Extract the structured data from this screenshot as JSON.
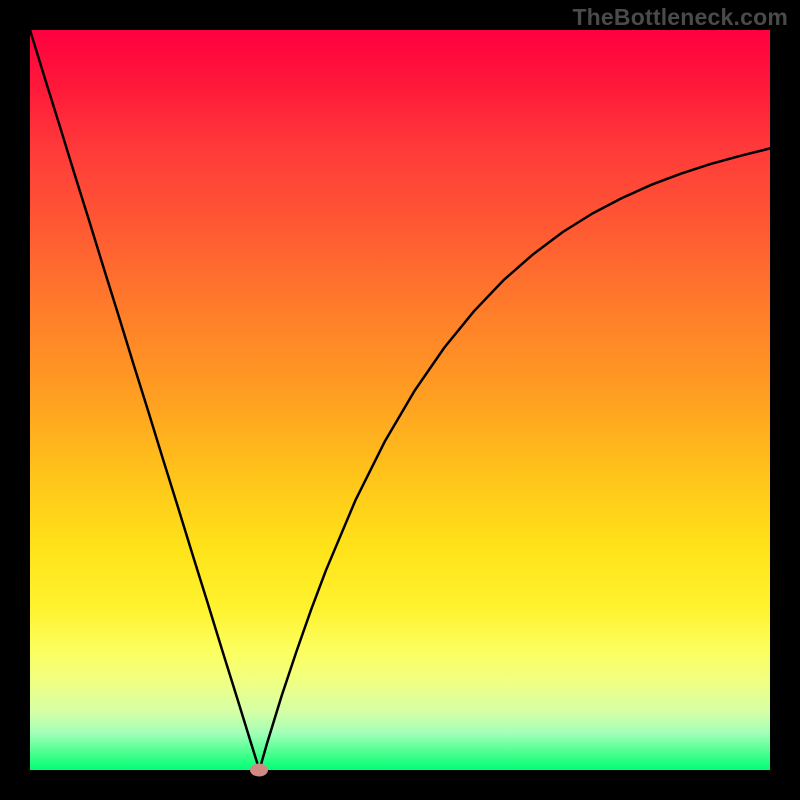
{
  "watermark": "TheBottleneck.com",
  "colors": {
    "frame": "#000000",
    "gradient_top": "#ff003f",
    "gradient_bottom": "#00ff77",
    "curve": "#000000",
    "dot": "#cf8b83"
  },
  "chart_data": {
    "type": "line",
    "title": "",
    "xlabel": "",
    "ylabel": "",
    "xlim": [
      0,
      100
    ],
    "ylim": [
      0,
      100
    ],
    "x": [
      0,
      2,
      4,
      6,
      8,
      10,
      12,
      14,
      16,
      18,
      20,
      22,
      24,
      26,
      28,
      30,
      31,
      32,
      34,
      36,
      38,
      40,
      44,
      48,
      52,
      56,
      60,
      64,
      68,
      72,
      76,
      80,
      84,
      88,
      92,
      96,
      100
    ],
    "values": [
      100,
      93.5,
      87.1,
      80.6,
      74.2,
      67.7,
      61.3,
      54.8,
      48.4,
      41.9,
      35.5,
      29.0,
      22.6,
      16.1,
      9.7,
      3.2,
      0,
      3.5,
      10.0,
      16.0,
      21.7,
      27.0,
      36.5,
      44.5,
      51.3,
      57.1,
      62.0,
      66.2,
      69.7,
      72.7,
      75.2,
      77.3,
      79.1,
      80.6,
      81.9,
      83.0,
      84.0
    ],
    "minimum_point": {
      "x": 31,
      "y": 0
    },
    "dot": {
      "x": 31,
      "y": 0
    }
  },
  "plot_geometry": {
    "inner_left": 30,
    "inner_top": 30,
    "inner_width": 740,
    "inner_height": 740
  }
}
